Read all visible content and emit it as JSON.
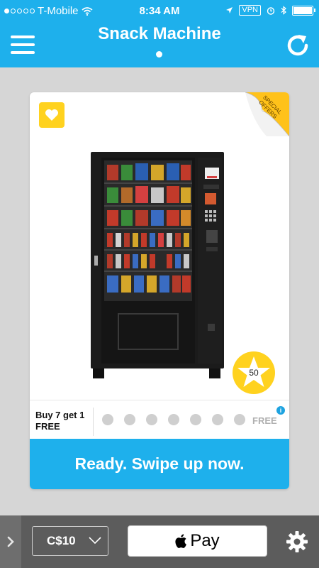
{
  "status": {
    "carrier": "T-Mobile",
    "time": "8:34 AM",
    "vpn": "VPN",
    "signal_filled": 1,
    "signal_total": 5
  },
  "header": {
    "title": "Snack Machine",
    "accent_color": "#1eb0ec"
  },
  "card": {
    "corner_ribbon": "SPECIAL OFFERS",
    "star_badge_value": "50",
    "offer_text": "Buy 7 get 1 FREE",
    "stamps_total": 7,
    "stamps_filled": 0,
    "free_label": "FREE",
    "info_icon": "i",
    "ready_text": "Ready. Swipe up now."
  },
  "bottom_bar": {
    "amount": "C$10",
    "pay_label": "Pay"
  },
  "colors": {
    "accent": "#1eb0ec",
    "badge_yellow": "#ffd21f",
    "bottom_bar": "#5c5c5c"
  }
}
